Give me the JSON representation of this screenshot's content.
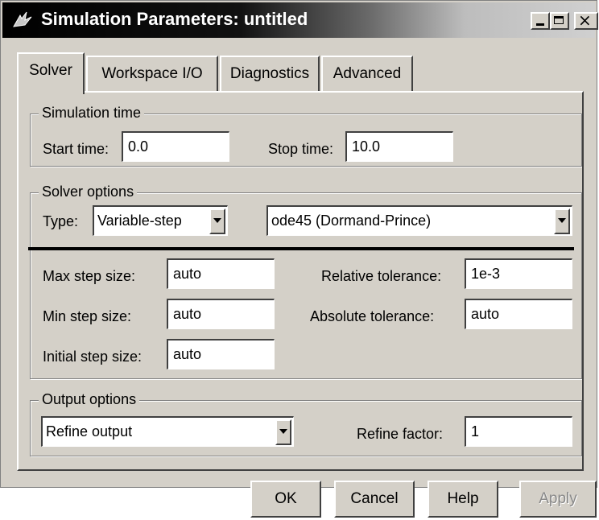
{
  "window": {
    "title": "Simulation Parameters: untitled"
  },
  "tabs": [
    {
      "label": "Solver"
    },
    {
      "label": "Workspace I/O"
    },
    {
      "label": "Diagnostics"
    },
    {
      "label": "Advanced"
    }
  ],
  "simulation_time": {
    "legend": "Simulation time",
    "start_label": "Start time:",
    "start_value": "0.0",
    "stop_label": "Stop time:",
    "stop_value": "10.0"
  },
  "solver_options": {
    "legend": "Solver options",
    "type_label": "Type:",
    "type_value": "Variable-step",
    "solver_value": "ode45 (Dormand-Prince)",
    "max_step_label": "Max step size:",
    "max_step_value": "auto",
    "min_step_label": "Min step size:",
    "min_step_value": "auto",
    "initial_step_label": "Initial step size:",
    "initial_step_value": "auto",
    "rel_tol_label": "Relative tolerance:",
    "rel_tol_value": "1e-3",
    "abs_tol_label": "Absolute tolerance:",
    "abs_tol_value": "auto"
  },
  "output_options": {
    "legend": "Output options",
    "output_value": "Refine output",
    "refine_label": "Refine factor:",
    "refine_value": "1"
  },
  "buttons": {
    "ok": "OK",
    "cancel": "Cancel",
    "help": "Help",
    "apply": "Apply"
  },
  "colors": {
    "face": "#d4d0c8",
    "title_text": "#ffffff"
  },
  "icons": {
    "app": "simulink-icon",
    "minimize": "minimize-icon",
    "maximize": "maximize-icon",
    "close": "close-icon"
  }
}
